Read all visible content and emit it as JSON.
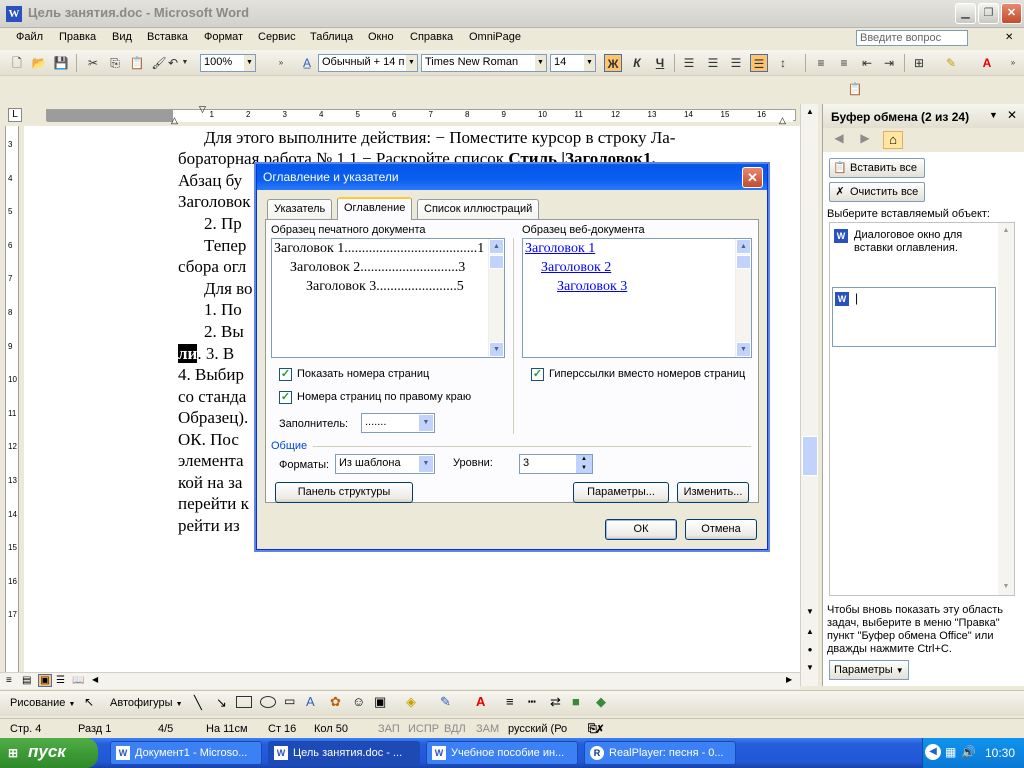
{
  "window": {
    "title": "Цель занятия.doc - Microsoft Word",
    "icon_letter": "W"
  },
  "menu": [
    "Файл",
    "Правка",
    "Вид",
    "Вставка",
    "Формат",
    "Сервис",
    "Таблица",
    "Окно",
    "Справка",
    "OmniPage"
  ],
  "ask_question_placeholder": "Введите вопрос",
  "toolbar": {
    "zoom": "100%",
    "style": "Обычный + 14 п",
    "font": "Times New Roman",
    "size": "14",
    "bold": "Ж",
    "italic": "К",
    "underline": "Ч"
  },
  "document": {
    "lines": [
      "Для этого выполните действия:  −  Поместите курсор в строку Ла-",
      "бораторная работа № 1.1  −  Раскройте  список  Стиль  |Заголовок1.",
      "Абзац бу",
      "Заголовок",
      "2.  Пр",
      "Тепер",
      "сбора  огл",
      "Для во",
      "1.  По",
      "2.  Вы",
      "ли.  3.  В",
      "4.  Выбир",
      "со  станда",
      "Образец).",
      "ОК.  Пос",
      "элемента",
      "кой  на  за",
      "перейти к",
      "рейти  из"
    ]
  },
  "dialog": {
    "title": "Оглавление и указатели",
    "tabs": [
      "Указатель",
      "Оглавление",
      "Список иллюстраций"
    ],
    "active_tab": "Оглавление",
    "print_preview_label": "Образец печатного документа",
    "print_preview": [
      {
        "text": "Заголовок 1",
        "dots": "......................................",
        "page": "1"
      },
      {
        "text": "Заголовок 2",
        "dots": "............................",
        "page": "3"
      },
      {
        "text": "Заголовок 3",
        "dots": ".......................",
        "page": "5"
      }
    ],
    "web_preview_label": "Образец веб-документа",
    "web_preview": [
      "Заголовок 1",
      "Заголовок 2",
      "Заголовок 3"
    ],
    "show_page_numbers": "Показать номера страниц",
    "right_align": "Номера страниц по правому краю",
    "hyperlinks": "Гиперссылки вместо номеров страниц",
    "filler_label": "Заполнитель:",
    "filler_value": ".......",
    "general_label": "Общие",
    "formats_label": "Форматы:",
    "formats_value": "Из шаблона",
    "levels_label": "Уровни:",
    "levels_value": "3",
    "outline_button": "Панель структуры",
    "params_button": "Параметры...",
    "modify_button": "Изменить...",
    "ok_button": "ОК",
    "cancel_button": "Отмена"
  },
  "pane": {
    "title": "Буфер обмена (2 из 24)",
    "paste_all": "Вставить все",
    "clear_all": "Очистить все",
    "select_label": "Выберите вставляемый объект:",
    "item1": "Диалоговое окно для вставки оглавления.",
    "item2": "|",
    "hint": "Чтобы вновь показать эту область задач, выберите в меню \"Правка\" пункт \"Буфер обмена Office\" или дважды нажмите Ctrl+C.",
    "options_button": "Параметры"
  },
  "drawing": {
    "draw": "Рисование",
    "autoshapes": "Автофигуры"
  },
  "status": {
    "page": "Стр.  4",
    "section": "Разд  1",
    "pages": "4/5",
    "at": "На  11см",
    "line": "Ст  16",
    "col": "Кол  50",
    "rec": "ЗАП",
    "trk": "ИСПР",
    "ext": "ВДЛ",
    "ovr": "ЗАМ",
    "lang": "русский (Ро"
  },
  "taskbar": {
    "start": "пуск",
    "tasks": [
      "Документ1 - Microso...",
      "Цель занятия.doc - ...",
      "Учебное пособие ин...",
      "RealPlayer: песня - 0..."
    ],
    "clock": "10:30"
  }
}
